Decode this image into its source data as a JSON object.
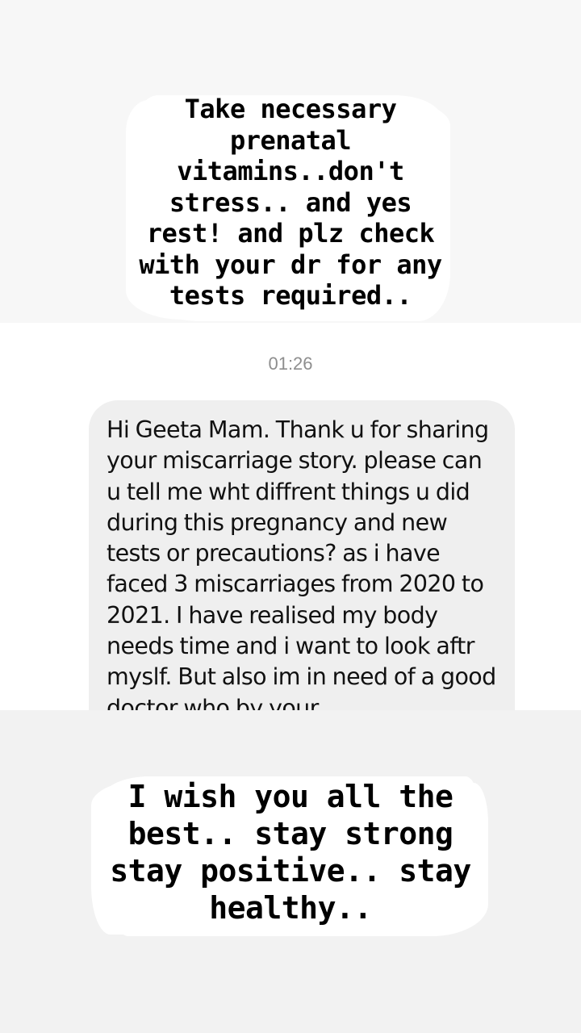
{
  "story_top": {
    "caption": "Take necessary prenatal vitamins..don't stress.. and yes rest! and plz check with your dr for any tests required.."
  },
  "chat": {
    "timestamp": "01:26",
    "message": "Hi Geeta Mam. Thank u for sharing your miscarriage story. please can u tell me wht diffrent things u did during this pregnancy and new tests or precautions? as i have faced 3 miscarriages from 2020 to 2021. I have realised my body needs time and i want to look aftr myslf. But also im in need of a good doctor who by your"
  },
  "story_bottom": {
    "caption": "I wish you all the best.. stay strong stay positive.. stay healthy.."
  }
}
